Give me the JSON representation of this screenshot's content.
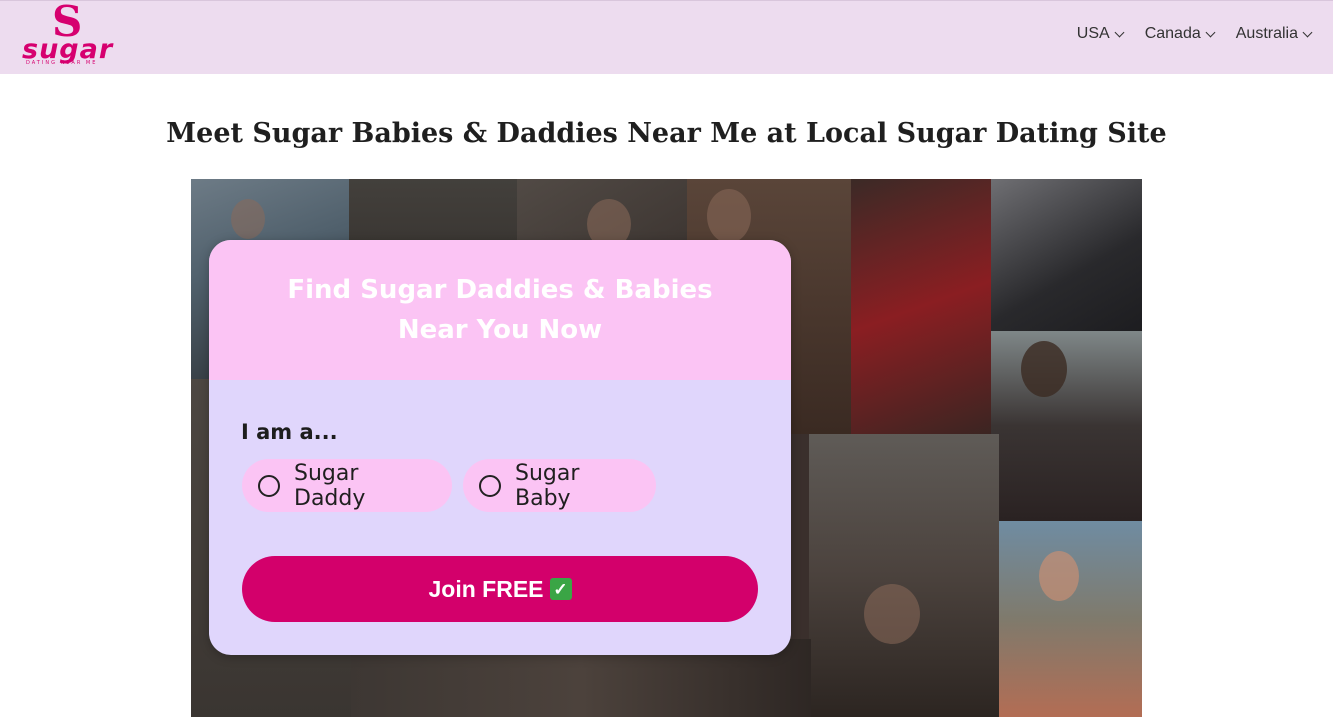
{
  "header": {
    "logo": {
      "letter": "S",
      "word": "sugar",
      "tagline": "DATING NEAR ME"
    },
    "nav": [
      {
        "label": "USA",
        "icon": "chevron-down-icon"
      },
      {
        "label": "Canada",
        "icon": "chevron-down-icon"
      },
      {
        "label": "Australia",
        "icon": "chevron-down-icon"
      }
    ]
  },
  "main": {
    "title": "Meet Sugar Babies & Daddies Near Me at Local Sugar Dating Site"
  },
  "signup_card": {
    "heading": "Find Sugar Daddies & Babies Near You Now",
    "question": "I am a...",
    "options": [
      {
        "label": "Sugar Daddy",
        "selected": false
      },
      {
        "label": "Sugar Baby",
        "selected": false
      }
    ],
    "submit_label": "Join FREE",
    "submit_icon": "check-mark-icon"
  },
  "colors": {
    "header_bg": "#eddcef",
    "brand_pink": "#d6006f",
    "card_top_bg": "#fbc4f4",
    "card_body_bg": "#e0d6fc",
    "button_bg": "#d3006b"
  }
}
